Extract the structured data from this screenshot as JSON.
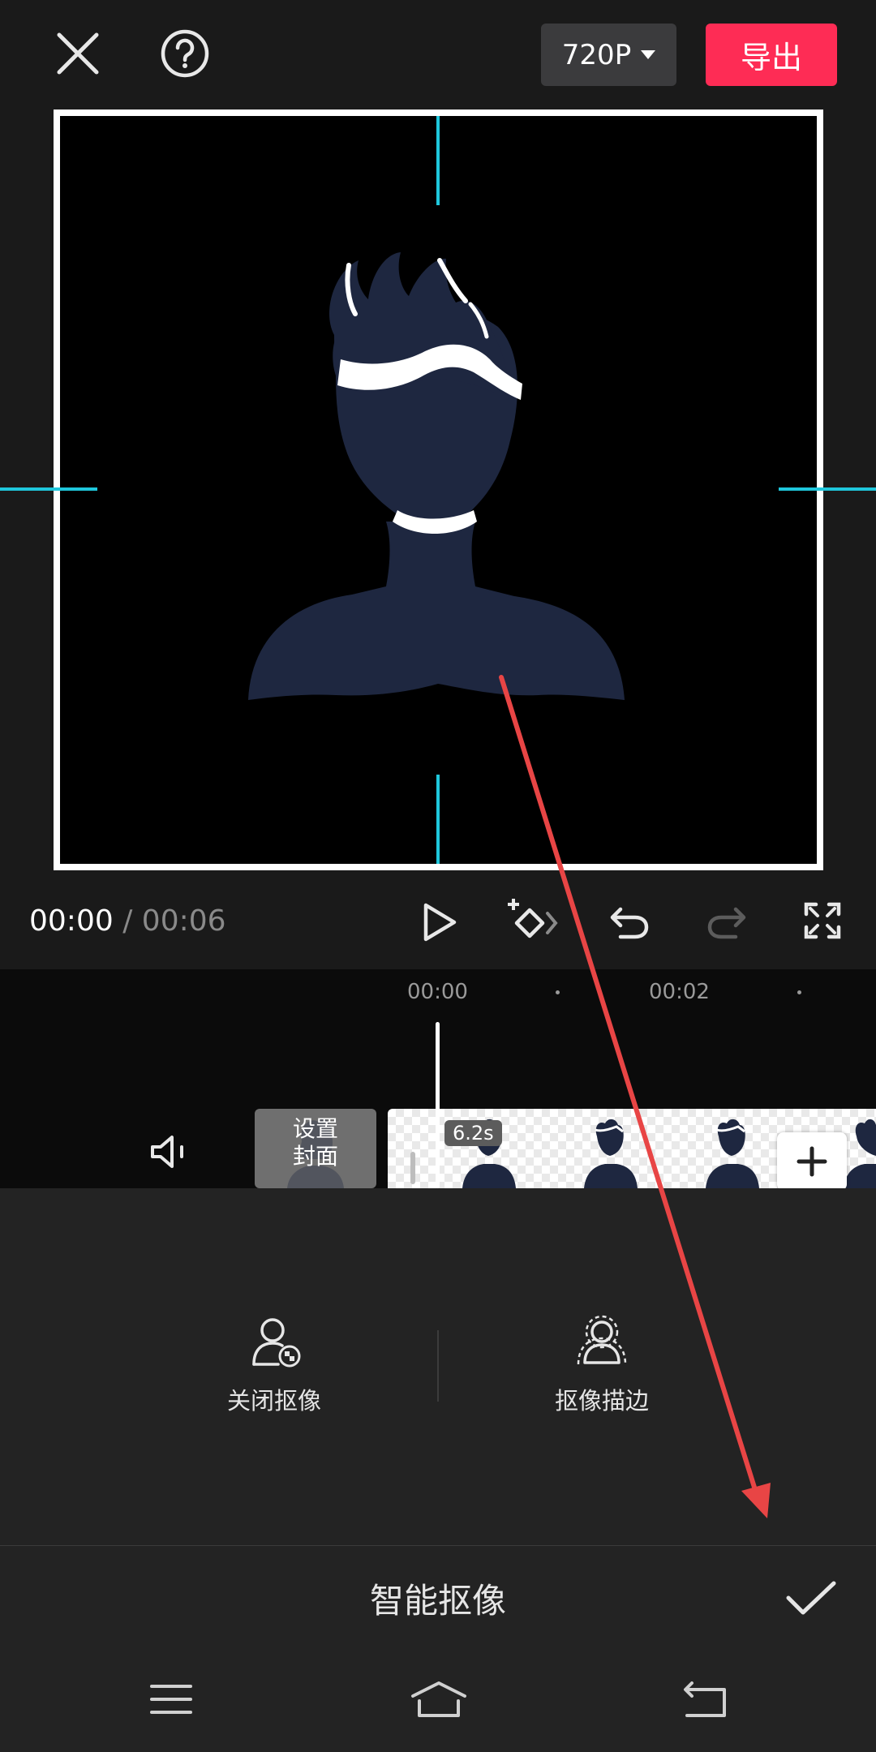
{
  "topbar": {
    "resolution": "720P",
    "export_label": "导出"
  },
  "player": {
    "time_current": "00:00",
    "time_separator": "/",
    "time_total": "00:06"
  },
  "timeline": {
    "ruler_labels": [
      "00:00",
      "00:02"
    ],
    "cover_label_line1": "设置",
    "cover_label_line2": "封面",
    "clip_duration": "6.2s"
  },
  "tools": {
    "close_cutout_label": "关闭抠像",
    "cutout_stroke_label": "抠像描边"
  },
  "sheet": {
    "title": "智能抠像"
  },
  "colors": {
    "accent_export": "#fe2c55",
    "guide_lines": "#1fc7dc",
    "annotation_arrow": "#e84545"
  }
}
